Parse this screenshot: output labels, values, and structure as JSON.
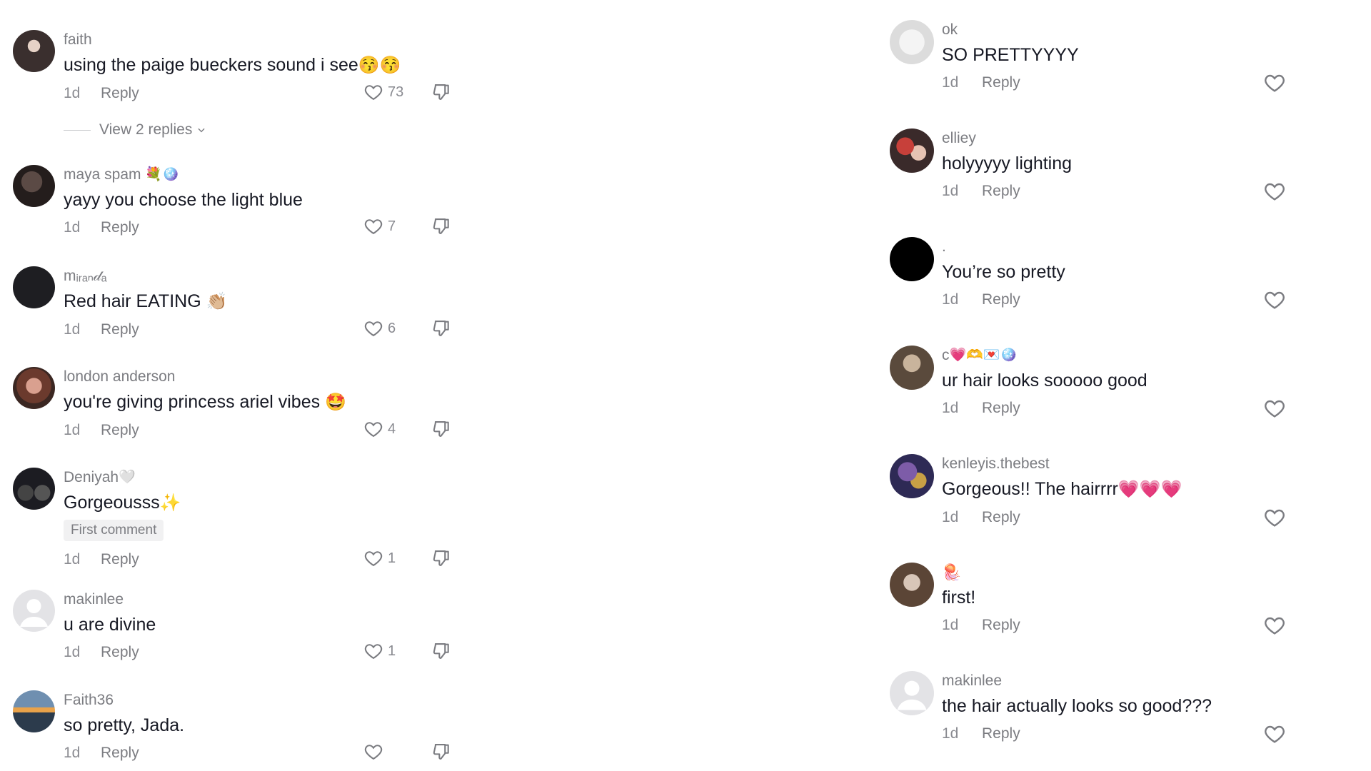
{
  "left_comments": [
    {
      "username": "faith",
      "text": "using the paige bueckers sound i see",
      "emoji": "😚😚",
      "time": "1d",
      "reply": "Reply",
      "likes": "73"
    },
    {
      "username": "maya spam",
      "username_emoji": "💐🪩",
      "text": "yayy you choose the light blue",
      "time": "1d",
      "reply": "Reply",
      "likes": "7"
    },
    {
      "username": "mᵢᵣₐₙ𝒹ₐ",
      "text": "Red hair EATING",
      "emoji": "👏🏼",
      "time": "1d",
      "reply": "Reply",
      "likes": "6"
    },
    {
      "username": "london anderson",
      "text": "you're giving princess ariel vibes",
      "emoji": "🤩",
      "time": "1d",
      "reply": "Reply",
      "likes": "4"
    },
    {
      "username": "Deniyah",
      "username_emoji": "🤍",
      "text": "Gorgeousss",
      "emoji": "✨",
      "badge": "First comment",
      "time": "1d",
      "reply": "Reply",
      "likes": "1"
    },
    {
      "username": "makinlee",
      "text": "u are divine",
      "time": "1d",
      "reply": "Reply",
      "likes": "1"
    },
    {
      "username": "Faith36",
      "text": "so pretty, Jada.",
      "time": "1d",
      "reply": "Reply",
      "likes": ""
    }
  ],
  "view_replies": "View 2 replies",
  "right_comments": [
    {
      "username": "ok",
      "text": "SO PRETTYYYY",
      "time": "1d",
      "reply": "Reply"
    },
    {
      "username": "elliey",
      "text": "holyyyyy lighting",
      "time": "1d",
      "reply": "Reply"
    },
    {
      "username": ".",
      "text": "You’re so pretty",
      "time": "1d",
      "reply": "Reply"
    },
    {
      "username": "c",
      "username_emoji": "💗🫶💌🪩",
      "text": "ur hair looks sooooo good",
      "time": "1d",
      "reply": "Reply"
    },
    {
      "username": "kenleyis.thebest",
      "text": "Gorgeous!! The hairrrr",
      "emoji": "💗💗💗",
      "time": "1d",
      "reply": "Reply"
    },
    {
      "username": "",
      "username_emoji": "🪼",
      "text": "first!",
      "time": "1d",
      "reply": "Reply"
    },
    {
      "username": "makinlee",
      "text": "the hair actually looks so good???",
      "time": "1d",
      "reply": "Reply"
    }
  ],
  "colors": {
    "text": "#161823",
    "secondary": "#7b7c81",
    "badge_bg": "#f1f1f2"
  }
}
